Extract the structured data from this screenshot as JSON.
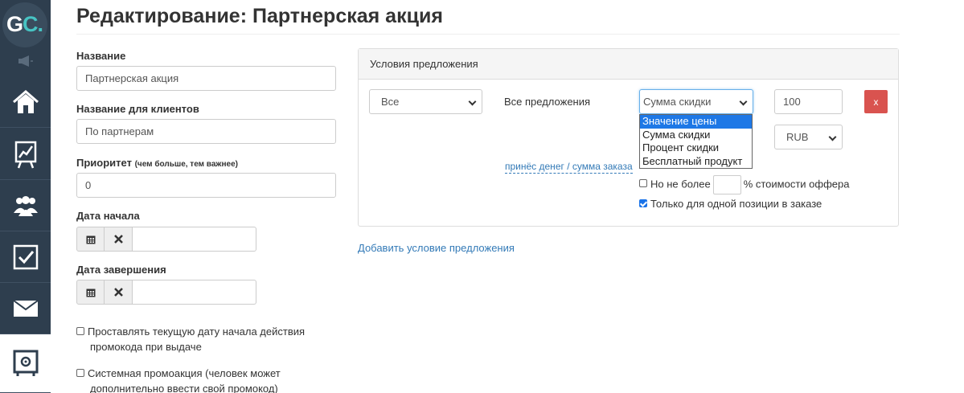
{
  "app": {
    "logo_text_g": "G",
    "logo_text_c": "C",
    "logo_dot": "."
  },
  "sidebar": {
    "items": [
      {
        "icon": "home-icon"
      },
      {
        "icon": "chart-board-icon"
      },
      {
        "icon": "users-icon"
      },
      {
        "icon": "checkbox-icon"
      },
      {
        "icon": "mail-icon"
      },
      {
        "icon": "safe-icon",
        "active": true
      }
    ]
  },
  "page": {
    "title": "Редактирование: Партнерская акция"
  },
  "form": {
    "name_label": "Название",
    "name_value": "Партнерская акция",
    "client_name_label": "Название для клиентов",
    "client_name_value": "По партнерам",
    "priority_label": "Приоритет",
    "priority_hint": "(чем больше, тем важнее)",
    "priority_value": "0",
    "start_date_label": "Дата начала",
    "end_date_label": "Дата завершения",
    "checkbox_start_line1": "Проставлять текущую дату начала действия",
    "checkbox_start_line2": "промокода при выдаче",
    "checkbox_system_line1": "Системная промоакция (человек может",
    "checkbox_system_line2": "дополнительно ввести свой промокод)"
  },
  "offer_panel": {
    "heading": "Условия предложения",
    "scope_select": "Все",
    "offers_text": "Все предложения",
    "type_select": "Сумма скидки",
    "amount_value": "100",
    "remove_label": "x",
    "currency_select": "RUB",
    "dropdown_options": [
      "Значение цены",
      "Сумма скидки",
      "Процент скидки",
      "Бесплатный продукт"
    ],
    "dropdown_highlight_index": 0,
    "profit_link": "принёс денег / сумма заказа",
    "no_more_than": "Но не более",
    "percent_of_offer": "% стоимости оффера",
    "single_position": "Только для одной позиции в заказе",
    "single_position_checked": true,
    "no_more_than_checked": false
  },
  "add_condition_link": "Добавить условие предложения",
  "colors": {
    "sidebar_bg": "#2e3e4e",
    "link": "#337ab7",
    "danger": "#d9534f",
    "highlight": "#1e78e6",
    "logo_accent": "#47c3c3"
  }
}
